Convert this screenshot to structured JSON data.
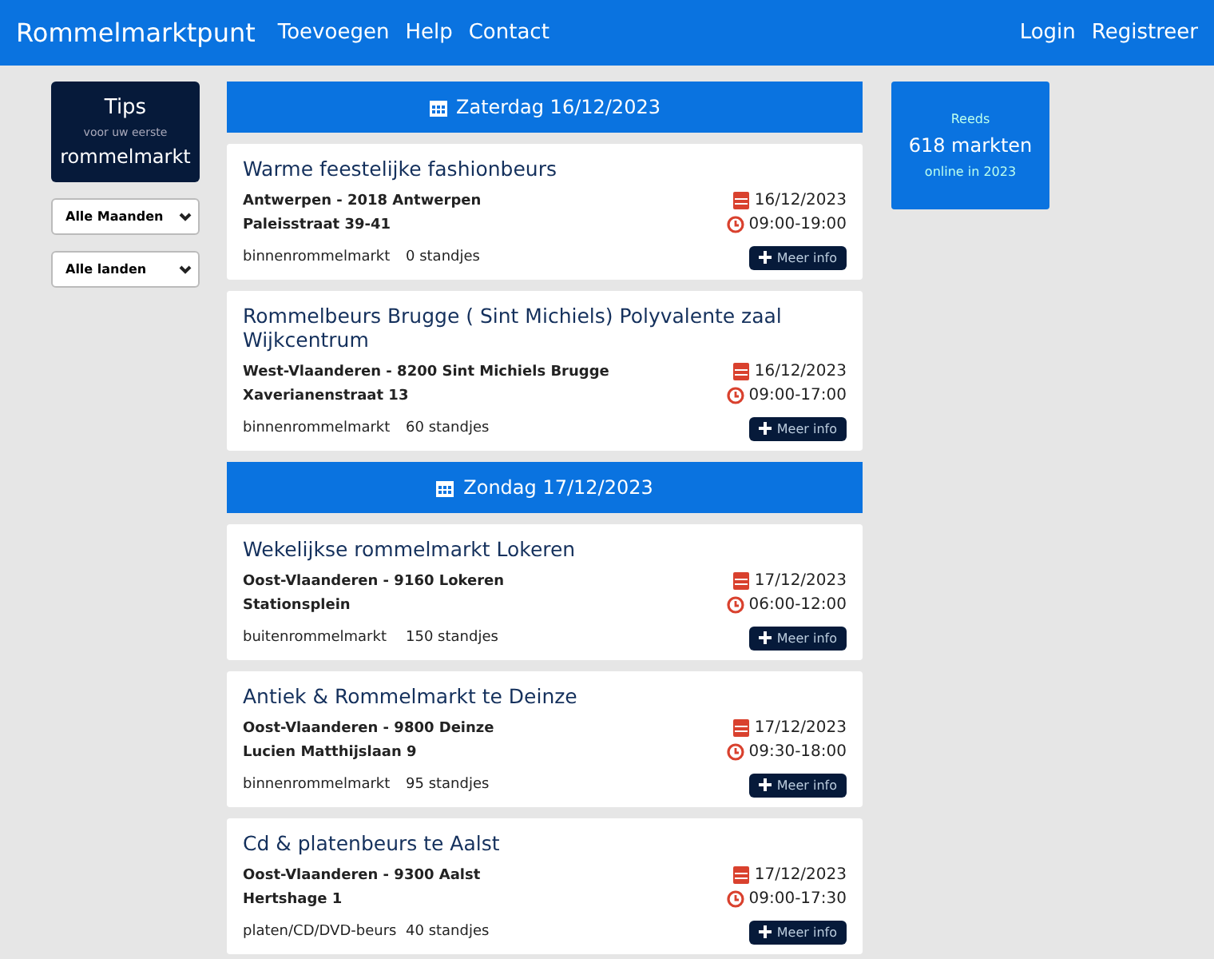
{
  "navbar": {
    "brand": "Rommelmarktpunt",
    "links": [
      "Toevoegen",
      "Help",
      "Contact"
    ],
    "right_links": [
      "Login",
      "Registreer"
    ]
  },
  "sidebar": {
    "tips": {
      "title": "Tips",
      "subtitle": "voor uw eerste",
      "main": "rommelmarkt"
    },
    "filters": [
      {
        "value": "Alle Maanden"
      },
      {
        "value": "Alle landen"
      }
    ]
  },
  "days": [
    {
      "heading": "Zaterdag 16/12/2023",
      "markets": [
        {
          "title": "Warme feestelijke fashionbeurs",
          "location": "Antwerpen - 2018 Antwerpen",
          "address": "Paleisstraat 39-41",
          "date": "16/12/2023",
          "time": "09:00-19:00",
          "type": "binnenrommelmarkt",
          "stands": "0 standjes",
          "button": "Meer info"
        },
        {
          "title": "Rommelbeurs Brugge ( Sint Michiels) Polyvalente zaal Wijkcentrum",
          "location": "West-Vlaanderen - 8200 Sint Michiels Brugge",
          "address": "Xaverianenstraat 13",
          "date": "16/12/2023",
          "time": "09:00-17:00",
          "type": "binnenrommelmarkt",
          "stands": "60 standjes",
          "button": "Meer info"
        }
      ]
    },
    {
      "heading": "Zondag 17/12/2023",
      "markets": [
        {
          "title": "Wekelijkse rommelmarkt Lokeren",
          "location": "Oost-Vlaanderen - 9160 Lokeren",
          "address": "Stationsplein",
          "date": "17/12/2023",
          "time": "06:00-12:00",
          "type": "buitenrommelmarkt",
          "stands": "150 standjes",
          "button": "Meer info"
        },
        {
          "title": "Antiek & Rommelmarkt te Deinze",
          "location": "Oost-Vlaanderen - 9800 Deinze",
          "address": "Lucien Matthijslaan 9",
          "date": "17/12/2023",
          "time": "09:30-18:00",
          "type": "binnenrommelmarkt",
          "stands": "95 standjes",
          "button": "Meer info"
        },
        {
          "title": "Cd & platenbeurs te Aalst",
          "location": "Oost-Vlaanderen - 9300 Aalst",
          "address": "Hertshage 1",
          "date": "17/12/2023",
          "time": "09:00-17:30",
          "type": "platen/CD/DVD-beurs",
          "stands": "40 standjes",
          "button": "Meer info"
        }
      ]
    }
  ],
  "stats": {
    "top": "Reeds",
    "main": "618 markten",
    "bottom": "online in 2023"
  }
}
